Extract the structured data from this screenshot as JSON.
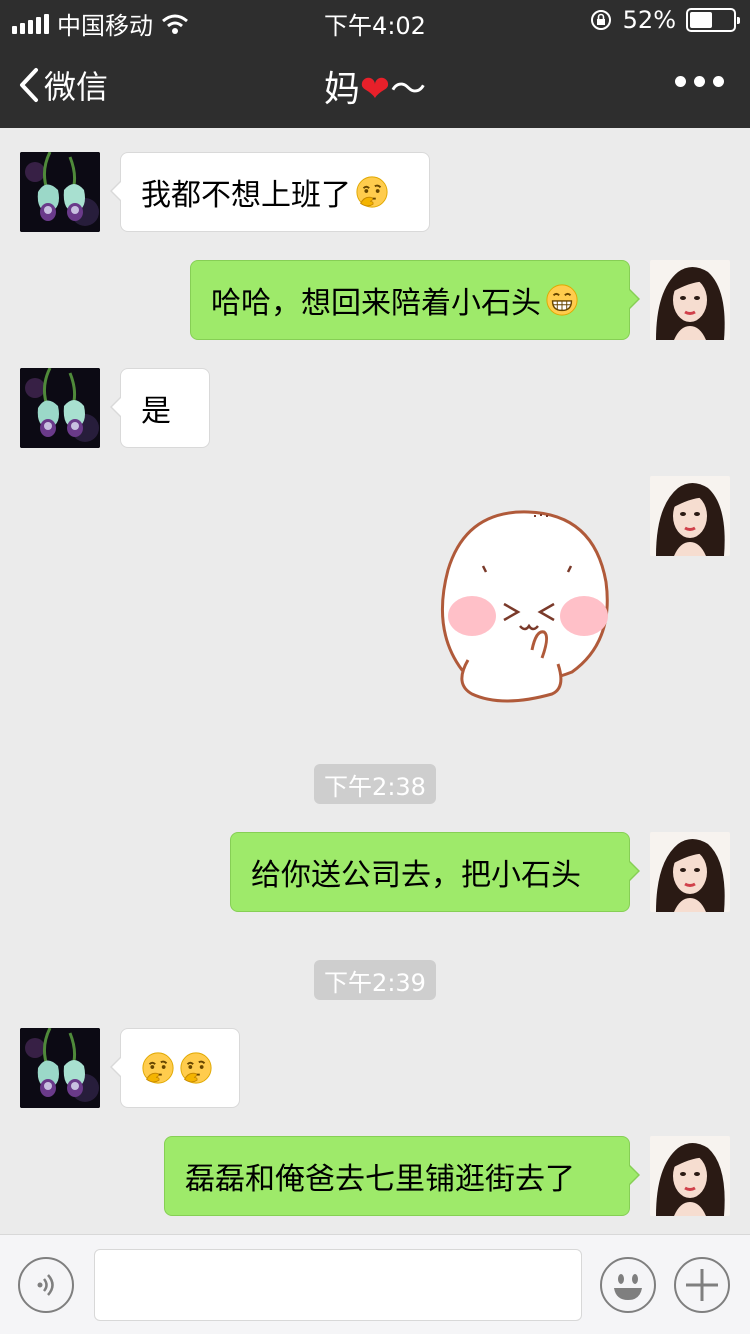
{
  "status_bar": {
    "carrier": "中国移动",
    "time": "下午4:02",
    "battery": "52%",
    "battery_level": 0.52
  },
  "nav": {
    "back_label": "微信",
    "title_name": "妈",
    "title_heart": "❤",
    "title_suffix": "～",
    "more_icon": "more-dots-icon"
  },
  "messages": [
    {
      "side": "in",
      "text": "我都不想上班了",
      "emoji": "thinking-face"
    },
    {
      "side": "out",
      "text": "哈哈，想回来陪着小石头",
      "emoji": "grinning-face"
    },
    {
      "side": "in",
      "text": "是"
    },
    {
      "side": "out",
      "type": "sticker",
      "sticker": "blushing-bun-sticker"
    },
    {
      "type": "timestamp",
      "text": "下午2:38"
    },
    {
      "side": "out",
      "text": "给你送公司去，把小石头"
    },
    {
      "type": "timestamp",
      "text": "下午2:39"
    },
    {
      "side": "in",
      "type": "emoji-only",
      "emoji": [
        "thinking-face",
        "thinking-face"
      ]
    },
    {
      "side": "out",
      "text": "磊磊和俺爸去七里铺逛街去了"
    }
  ],
  "input_bar": {
    "voice_icon": "voice-icon",
    "emoji_icon": "smiley-icon",
    "plus_icon": "plus-icon",
    "value": ""
  },
  "colors": {
    "header_bg": "#2e2e2e",
    "chat_bg": "#ebebeb",
    "outgoing_bubble": "#9eea6a",
    "incoming_bubble": "#ffffff",
    "timestamp_bg": "#cecece"
  }
}
